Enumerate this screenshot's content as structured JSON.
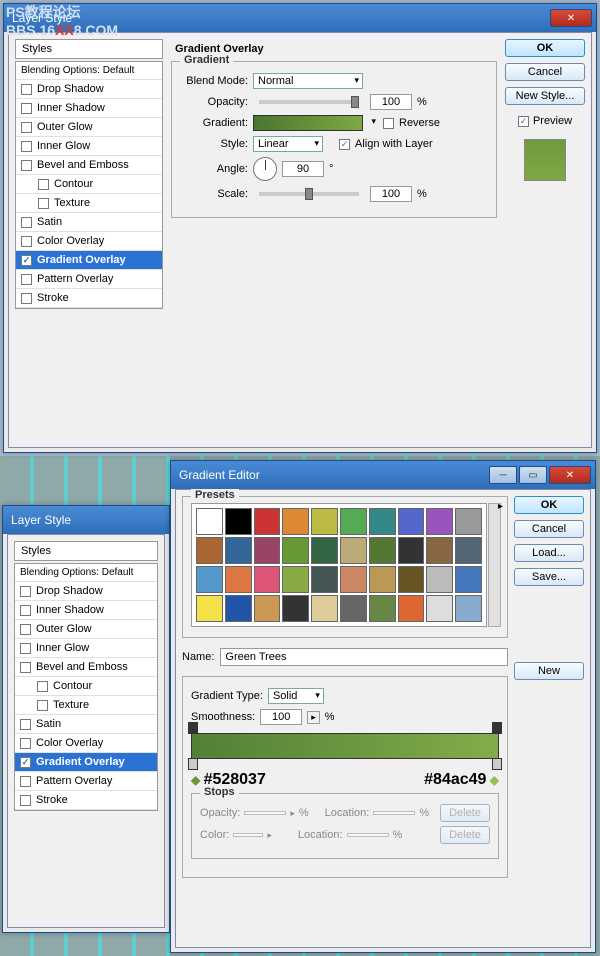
{
  "watermark": {
    "line1": "PS教程论坛",
    "line2_pre": "BBS.16",
    "line2_x": "XX",
    "line2_post": "8.COM"
  },
  "win1": {
    "title": "Layer Style",
    "styles_header": "Styles",
    "blending_options": "Blending Options: Default",
    "effects": [
      "Drop Shadow",
      "Inner Shadow",
      "Outer Glow",
      "Inner Glow",
      "Bevel and Emboss",
      "Contour",
      "Texture",
      "Satin",
      "Color Overlay",
      "Gradient Overlay",
      "Pattern Overlay",
      "Stroke"
    ],
    "selected_effect": "Gradient Overlay",
    "panel_title": "Gradient Overlay",
    "gradient_group": "Gradient",
    "labels": {
      "blend_mode": "Blend Mode:",
      "opacity": "Opacity:",
      "gradient": "Gradient:",
      "style": "Style:",
      "angle": "Angle:",
      "scale": "Scale:",
      "reverse": "Reverse",
      "align": "Align with Layer"
    },
    "values": {
      "blend_mode": "Normal",
      "opacity": "100",
      "style": "Linear",
      "angle": "90",
      "scale": "100",
      "pct": "%",
      "deg": "°"
    },
    "buttons": {
      "ok": "OK",
      "cancel": "Cancel",
      "new_style": "New Style...",
      "preview": "Preview"
    }
  },
  "win2": {
    "title": "Layer Style",
    "styles_header": "Styles",
    "blending_options": "Blending Options: Default",
    "effects": [
      "Drop Shadow",
      "Inner Shadow",
      "Outer Glow",
      "Inner Glow",
      "Bevel and Emboss",
      "Contour",
      "Texture",
      "Satin",
      "Color Overlay",
      "Gradient Overlay",
      "Pattern Overlay",
      "Stroke"
    ],
    "selected_effect": "Gradient Overlay"
  },
  "ge": {
    "title": "Gradient Editor",
    "presets_label": "Presets",
    "name_label": "Name:",
    "name_value": "Green Trees",
    "grad_type_label": "Gradient Type:",
    "grad_type_value": "Solid",
    "smoothness_label": "Smoothness:",
    "smoothness_value": "100",
    "pct": "%",
    "hex_left": "#528037",
    "hex_right": "#84ac49",
    "stops_label": "Stops",
    "opacity_label": "Opacity:",
    "location_label": "Location:",
    "color_label": "Color:",
    "buttons": {
      "ok": "OK",
      "cancel": "Cancel",
      "load": "Load...",
      "save": "Save...",
      "new": "New",
      "delete": "Delete"
    },
    "preset_colors": [
      "#ffffff",
      "#000000",
      "#cc3333",
      "#dd8833",
      "#bbbb44",
      "#55aa55",
      "#338888",
      "#5566cc",
      "#9955bb",
      "#999999",
      "#aa6633",
      "#336699",
      "#994466",
      "#669933",
      "#336644",
      "#bbaa77",
      "#557733",
      "#333333",
      "#886644",
      "#556677",
      "#5599cc",
      "#dd7744",
      "#dd5577",
      "#88aa44",
      "#445555",
      "#cc8866",
      "#bb9955",
      "#665522",
      "#bbbbbb",
      "#4477bb",
      "#f4e14a",
      "#2255aa",
      "#cc9955",
      "#333333",
      "#ddcc99",
      "#666666",
      "#668844",
      "#dd6633",
      "#dddddd",
      "#88aacc"
    ]
  }
}
